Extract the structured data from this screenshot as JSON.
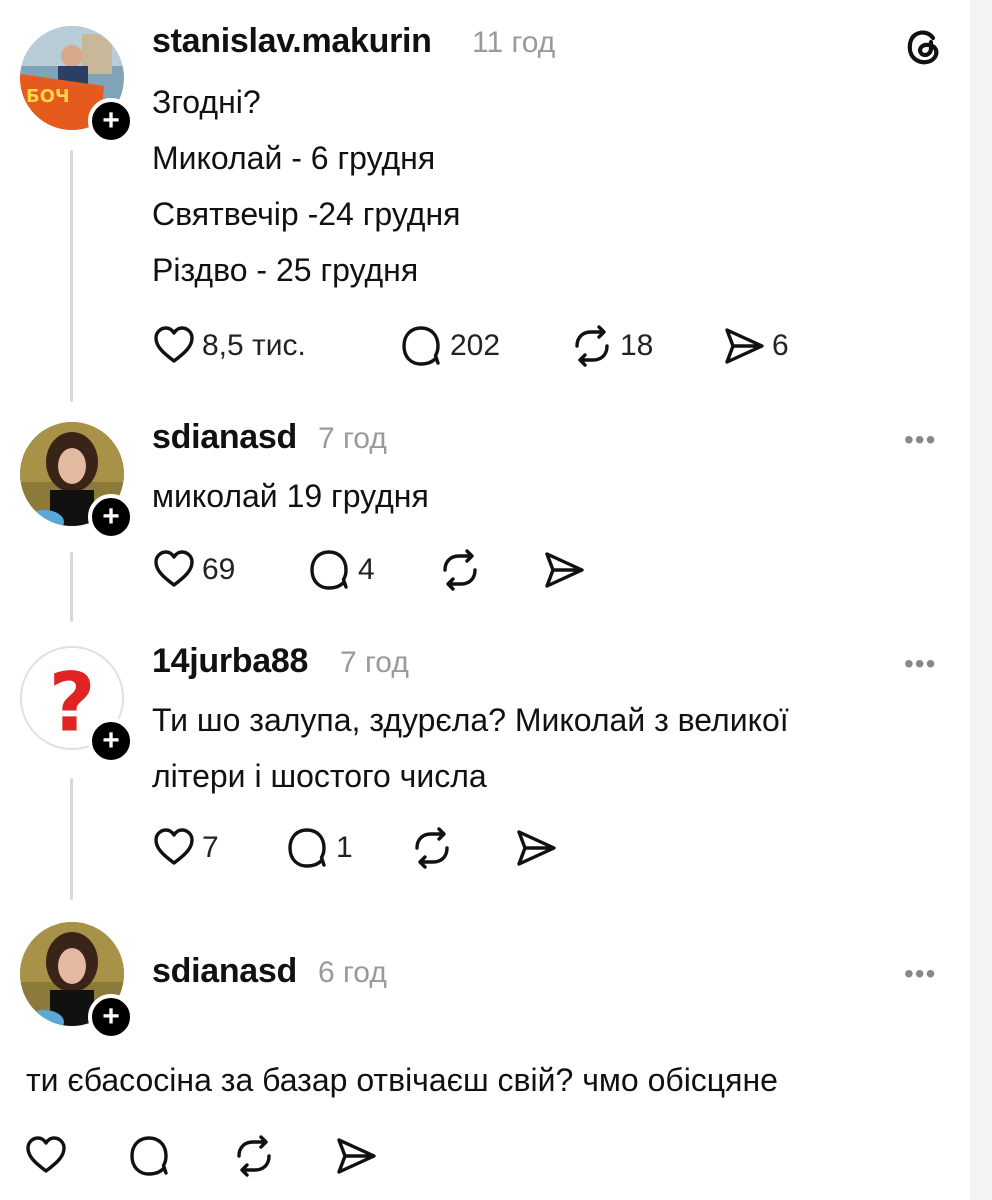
{
  "post": {
    "username": "stanislav.makurin",
    "time": "11 год",
    "lines": [
      "Згодні?",
      "Миколай - 6 грудня",
      "Святвечір -24 грудня",
      "Різдво - 25 грудня"
    ],
    "likes": "8,5 тис.",
    "replies": "202",
    "reposts": "18",
    "shares": "6",
    "avatar_banner_text": "БОЧ"
  },
  "comments": [
    {
      "username": "sdianasd",
      "time": "7 год",
      "lines": [
        "миколай 19 грудня"
      ],
      "likes": "69",
      "replies": "4",
      "reposts": "",
      "shares": ""
    },
    {
      "username": "14jurba88",
      "time": "7 год",
      "lines": [
        "Ти шо залупа, здурєла? Миколай з великої",
        "літери і шостого числа"
      ],
      "likes": "7",
      "replies": "1",
      "reposts": "",
      "shares": "",
      "avatar_symbol": "?"
    },
    {
      "username": "sdianasd",
      "time": "6 год",
      "lines": [
        "ти єбасосіна за базар отвічаєш свій? чмо обісцяне"
      ],
      "likes": "",
      "replies": "",
      "reposts": "",
      "shares": ""
    }
  ],
  "ui": {
    "follow_symbol": "+",
    "more_symbol": "•••",
    "icons": [
      "threads-logo-icon",
      "heart-icon",
      "comment-icon",
      "repost-icon",
      "share-icon",
      "plus-icon",
      "more-icon"
    ],
    "colors": {
      "text": "#111111",
      "muted": "#9a9a9a",
      "thread_line": "#d9d9d9",
      "badge": "#000000"
    }
  }
}
